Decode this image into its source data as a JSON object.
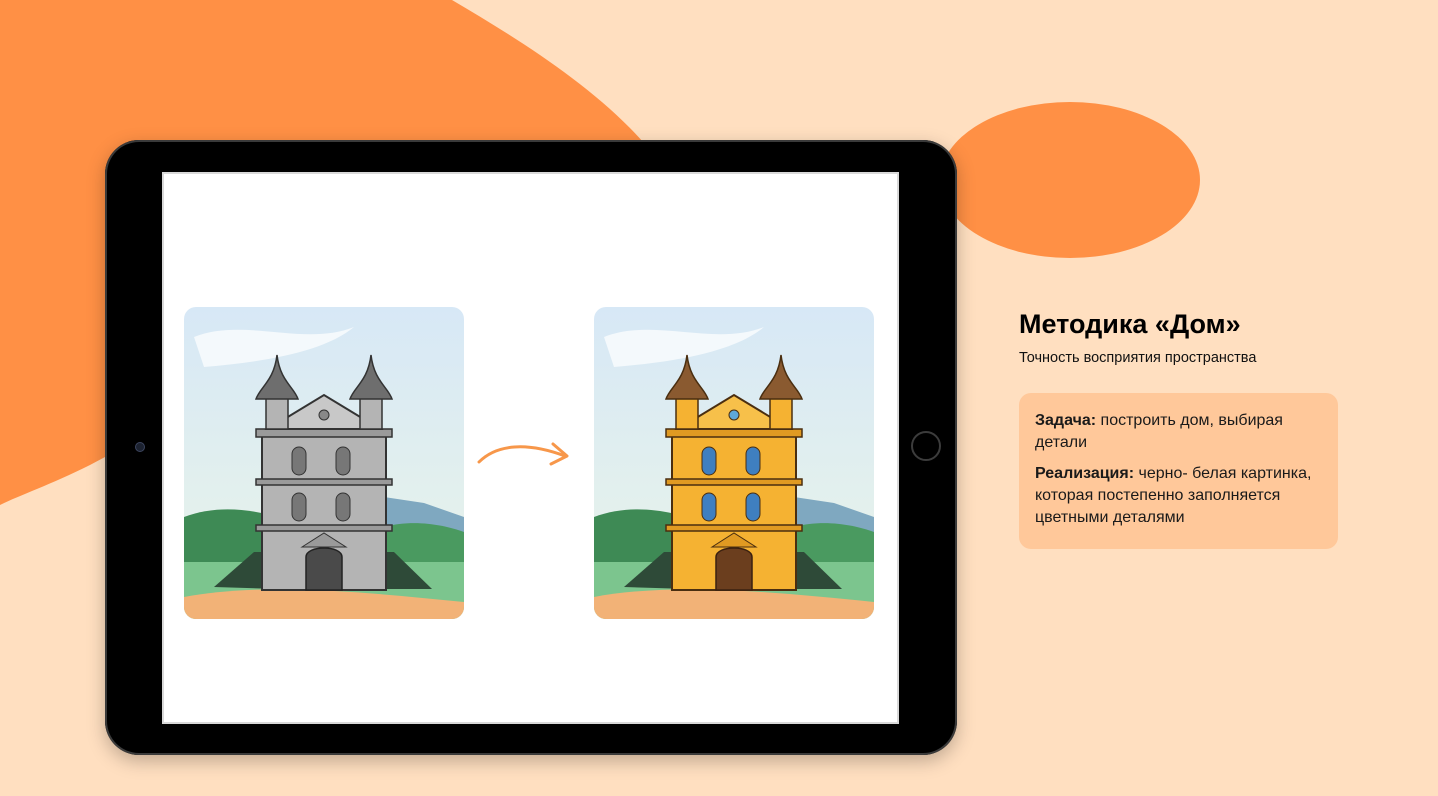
{
  "slide": {
    "title": "Методика «Дом»",
    "subtitle": "Точность восприятия пространства"
  },
  "info": {
    "task_label": "Задача:",
    "task_text": " построить дом, выбирая детали",
    "impl_label": "Реализация:",
    "impl_text": " черно- белая картинка, которая постепенно заполняется цветными деталями"
  },
  "colors": {
    "background": "#FFDFC0",
    "accent": "#FF9045",
    "card": "#FFC89A",
    "house_color": "#F5B232",
    "house_gray": "#B4B4B4"
  },
  "icons": {
    "arrow": "arrow-right-curved-icon",
    "camera": "tablet-camera-icon",
    "home_button": "tablet-home-button-icon"
  }
}
